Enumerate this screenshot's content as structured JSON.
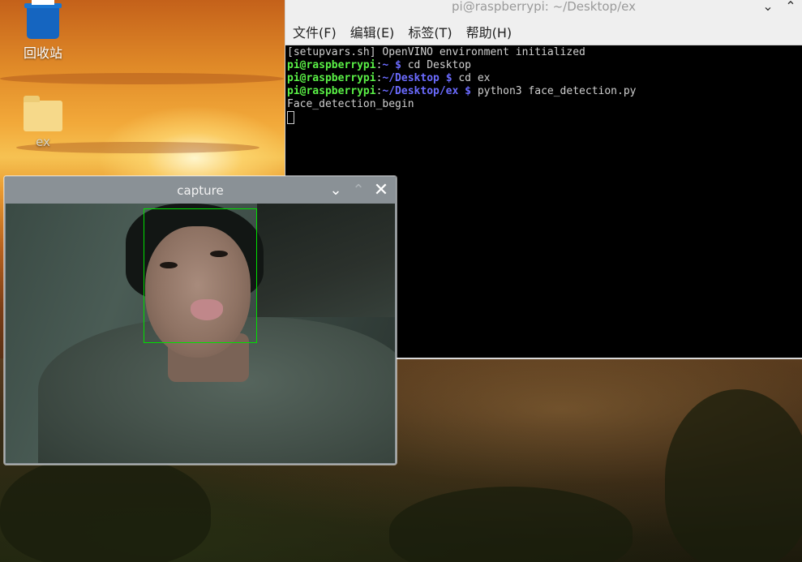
{
  "desktop": {
    "icons": [
      {
        "label": "回收站",
        "icon": "trash-icon"
      },
      {
        "label": "ex",
        "icon": "folder-icon"
      }
    ]
  },
  "terminal": {
    "title": "pi@raspberrypi: ~/Desktop/ex",
    "menu": [
      {
        "label": "文件(F)"
      },
      {
        "label": "编辑(E)"
      },
      {
        "label": "标签(T)"
      },
      {
        "label": "帮助(H)"
      }
    ],
    "lines": {
      "l1": "[setupvars.sh] OpenVINO environment initialized",
      "l2_user": "pi@raspberrypi",
      "l2_path": "~",
      "l2_cmd": "cd Desktop",
      "l3_user": "pi@raspberrypi",
      "l3_path": "~/Desktop",
      "l3_cmd": "cd ex",
      "l4_user": "pi@raspberrypi",
      "l4_path": "~/Desktop/ex",
      "l4_cmd": "python3 face_detection.py",
      "l5": "Face_detection_begin"
    },
    "glyphs": {
      "minimize": "⌄",
      "maximize": "⌃",
      "sep": ":",
      "dollar": "$"
    }
  },
  "capture": {
    "title": "capture",
    "glyphs": {
      "minimize": "⌄",
      "maximize": "⌃",
      "close": "✕"
    },
    "colors": {
      "face_box": "#00e000"
    }
  }
}
